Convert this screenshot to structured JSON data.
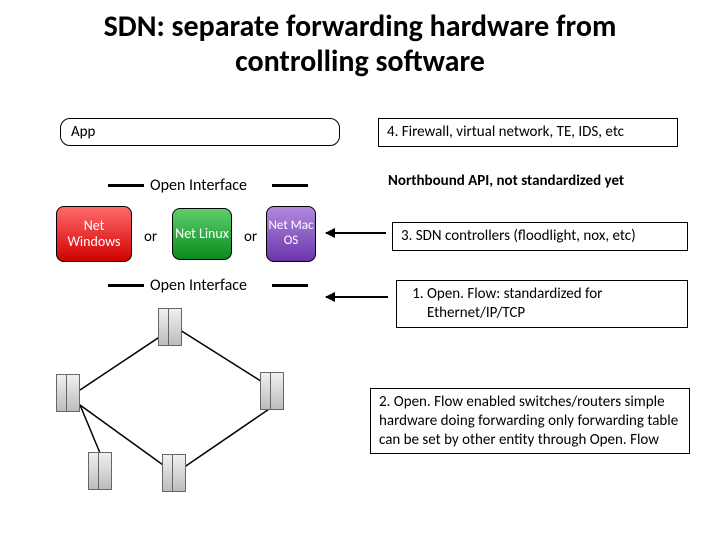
{
  "title": "SDN: separate forwarding hardware from controlling software",
  "app": {
    "label": "App"
  },
  "open_interface_upper": "Open Interface",
  "open_interface_lower": "Open Interface",
  "or1": "or",
  "or2": "or",
  "os": {
    "windows": "Net Windows",
    "linux": "Net Linux",
    "mac": "Net Mac OS"
  },
  "notes": {
    "n4": "4. Firewall, virtual network, TE, IDS, etc",
    "nb": "Northbound API, not standardized yet",
    "n3": "3. SDN controllers (floodlight, nox, etc)",
    "n1_prefix": "1.",
    "n1_body": "Open. Flow: standardized for Ethernet/IP/TCP",
    "n2": "2. Open. Flow enabled switches/routers simple hardware doing forwarding only forwarding table can be set by other entity through Open. Flow"
  }
}
